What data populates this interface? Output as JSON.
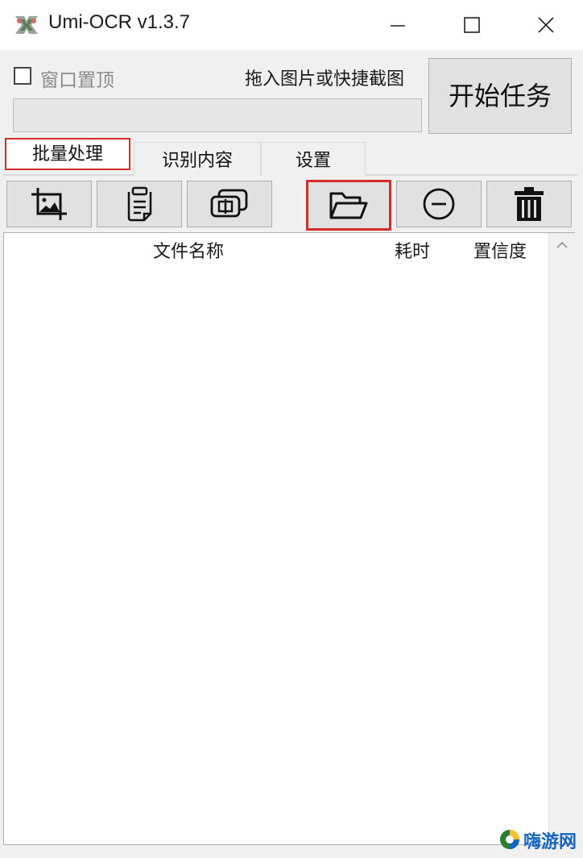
{
  "window": {
    "title": "Umi-OCR v1.3.7",
    "icon": "umi-ocr-icon"
  },
  "controls": {
    "pin_label": "窗口置顶",
    "pin_checked": false,
    "drop_hint": "拖入图片或快捷截图",
    "start_label": "开始任务"
  },
  "tabs": [
    {
      "label": "批量处理",
      "selected": true
    },
    {
      "label": "识别内容",
      "selected": false
    },
    {
      "label": "设置",
      "selected": false
    }
  ],
  "toolbar": [
    {
      "icon": "screenshot-icon"
    },
    {
      "icon": "clipboard-icon"
    },
    {
      "icon": "batch-capture-icon"
    },
    {
      "icon": "open-folder-icon",
      "highlighted": true
    },
    {
      "icon": "remove-icon"
    },
    {
      "icon": "trash-icon"
    }
  ],
  "table": {
    "columns": [
      "文件名称",
      "耗时",
      "置信度"
    ],
    "rows": []
  },
  "watermark": {
    "text": "嗨游网"
  },
  "colors": {
    "highlight": "#d42b2b",
    "watermark": "#1565c0"
  }
}
